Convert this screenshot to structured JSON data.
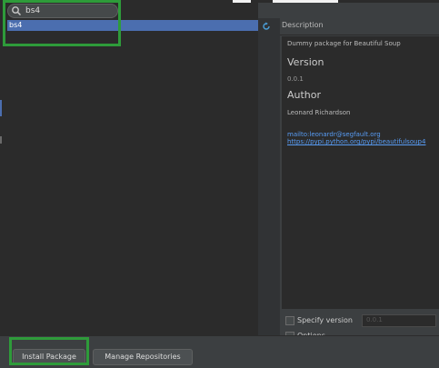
{
  "search": {
    "value": "bs4"
  },
  "packages": [
    {
      "name": "bs4",
      "selected": true
    }
  ],
  "description": {
    "header": "Description",
    "summary": "Dummy package for Beautiful Soup",
    "version_heading": "Version",
    "version": "0.0.1",
    "author_heading": "Author",
    "author": "Leonard Richardson",
    "links": [
      "mailto:leonardr@segfault.org",
      "https://pypi.python.org/pypi/beautifulsoup4"
    ]
  },
  "options": {
    "specify_version": "Specify version",
    "specify_version_value": "0.0.1",
    "options_label": "Options"
  },
  "buttons": {
    "install": "Install Package",
    "manage": "Manage Repositories"
  },
  "colors": {
    "selection": "#4b6eaf",
    "link": "#589df6",
    "highlight": "#2e9b3a"
  },
  "icons": [
    "search-icon",
    "refresh-icon"
  ]
}
